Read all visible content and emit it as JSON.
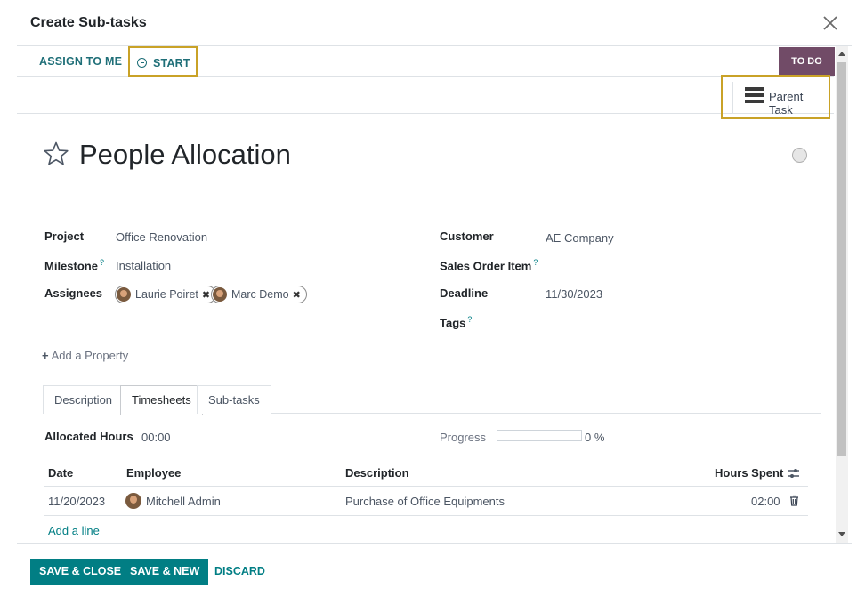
{
  "dialog": {
    "title": "Create Sub-tasks"
  },
  "statusbar": {
    "assign_label": "ASSIGN TO ME",
    "start_label": "START",
    "stage_label": "TO DO"
  },
  "button_box": {
    "parent_task_label": "Parent Task"
  },
  "task": {
    "name": "People Allocation",
    "fields_left": [
      {
        "label": "Project",
        "value": "Office Renovation"
      },
      {
        "label": "Milestone",
        "value": "Installation"
      },
      {
        "label": "Assignees",
        "value": ""
      }
    ],
    "fields_right": [
      {
        "label": "Customer",
        "value": "AE Company"
      },
      {
        "label": "Sales Order Item",
        "value": ""
      },
      {
        "label": "Deadline",
        "value": "11/30/2023"
      },
      {
        "label": "Tags",
        "value": ""
      }
    ],
    "help_marker": "?",
    "assignees": [
      "Laurie Poiret",
      "Marc Demo"
    ],
    "tag_remove": "✖",
    "add_property": "Add a Property"
  },
  "tabs": [
    "Description",
    "Timesheets",
    "Sub-tasks"
  ],
  "active_tab": "Timesheets",
  "timesheets": {
    "allocated_label": "Allocated Hours",
    "allocated_value": "00:00",
    "progress_label": "Progress",
    "progress_value": 0,
    "progress_text": "0 %",
    "columns": [
      "Date",
      "Employee",
      "Description",
      "Hours Spent"
    ],
    "rows": [
      {
        "date": "11/20/2023",
        "employee": "Mitchell Admin",
        "description": "Purchase of Office Equipments",
        "hours": "02:00"
      }
    ],
    "add_line": "Add a line"
  },
  "footer": {
    "save_close": "SAVE & CLOSE",
    "save_new": "SAVE & NEW",
    "discard": "DISCARD"
  },
  "colors": {
    "primary": "#017e84",
    "stage": "#714b67",
    "highlight": "#c9a227"
  }
}
